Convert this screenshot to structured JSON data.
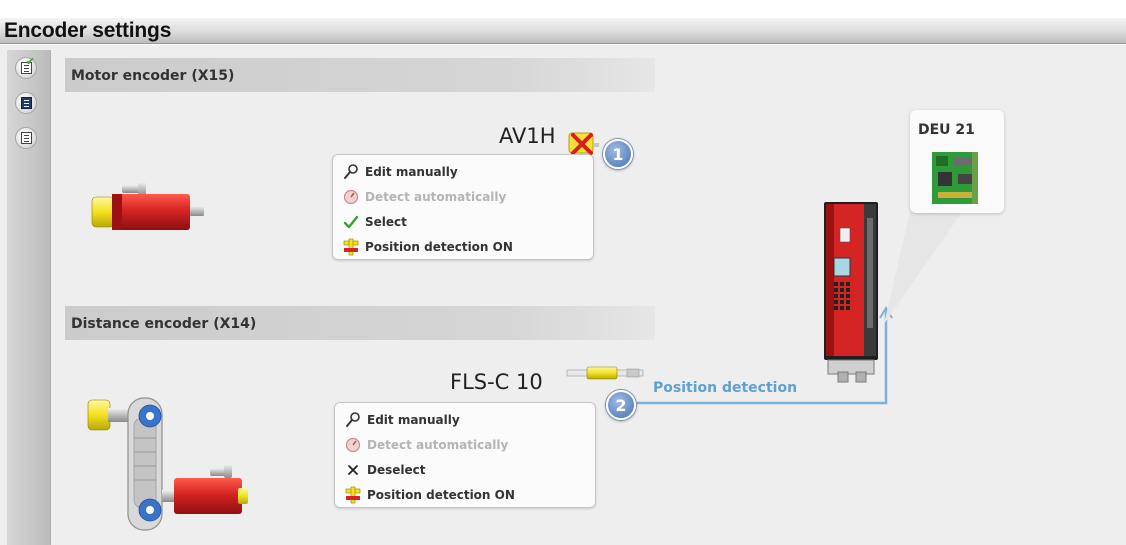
{
  "window": {
    "title": "Encoder settings"
  },
  "sidebar": {
    "buttons": [
      {
        "name": "sidebar-button-1",
        "icon": "page-check-icon"
      },
      {
        "name": "sidebar-button-2",
        "icon": "page-dark-icon"
      },
      {
        "name": "sidebar-button-3",
        "icon": "page-icon"
      }
    ]
  },
  "motor_encoder": {
    "header": "Motor encoder (X15)",
    "encoder_name": "AV1H",
    "status_icon": "error-x-icon",
    "badge": "1",
    "menu": {
      "edit_manually": "Edit manually",
      "detect_automatically": "Detect automatically",
      "select": "Select",
      "position_detection": "Position detection ON"
    }
  },
  "distance_encoder": {
    "header": "Distance encoder (X14)",
    "encoder_name": "FLS-C 10",
    "badge": "2",
    "menu": {
      "edit_manually": "Edit manually",
      "detect_automatically": "Detect automatically",
      "deselect": "Deselect",
      "position_detection": "Position detection ON"
    }
  },
  "device": {
    "card_label": "DEU 21"
  },
  "connection": {
    "label": "Position detection"
  },
  "colors": {
    "accent_blue": "#5fa0d2",
    "badge_blue": "#6a8fc6",
    "motor_red": "#d42424",
    "connector_yellow": "#f2e21c",
    "disabled_text": "#b4b4b4"
  }
}
